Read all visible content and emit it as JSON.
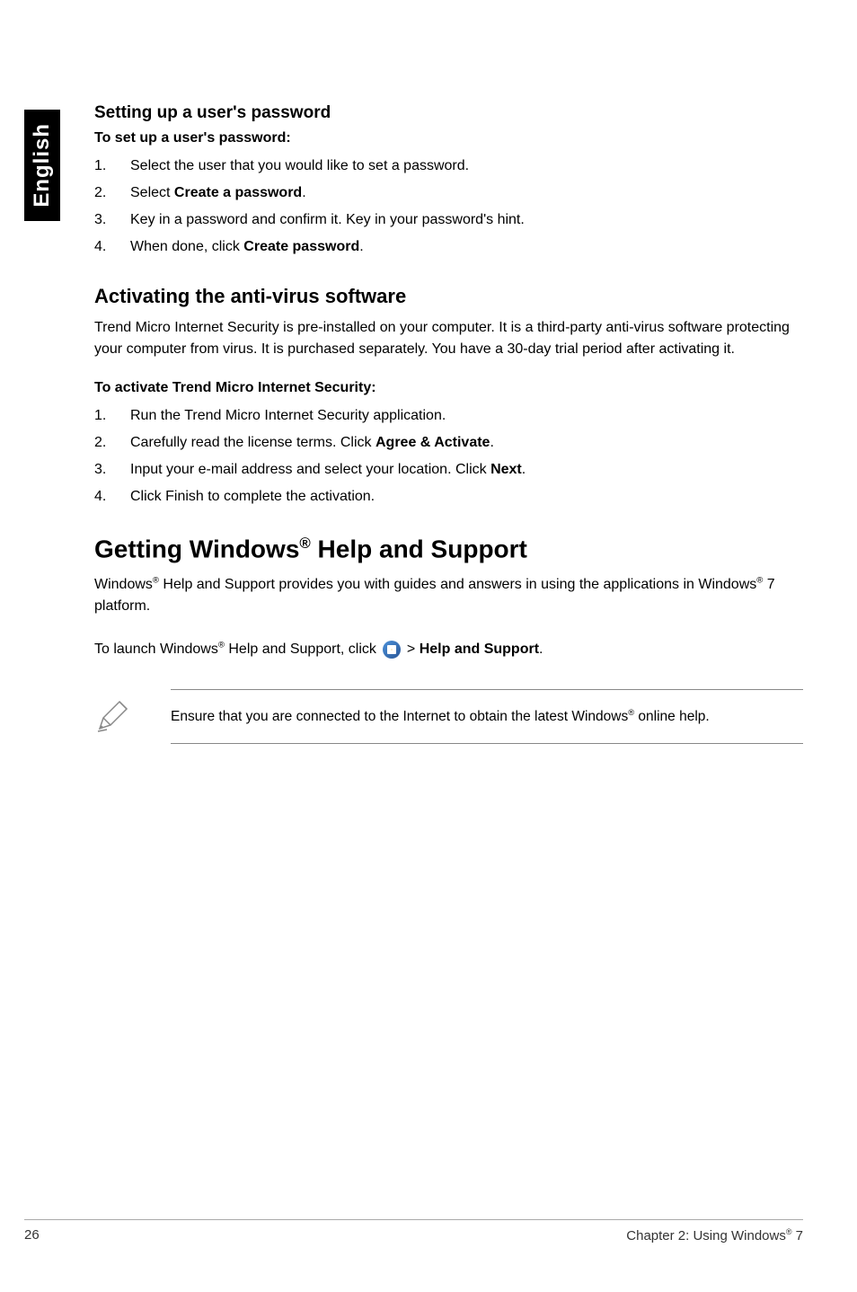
{
  "sideTab": "English",
  "section1": {
    "title": "Setting up a user's password",
    "intro": "To set up a user's password:",
    "items": [
      {
        "num": "1.",
        "pre": "Select the user that you would like to set a password."
      },
      {
        "num": "2.",
        "pre": "Select ",
        "bold": "Create a password",
        "post": "."
      },
      {
        "num": "3.",
        "pre": "Key in a password and confirm it. Key in your password's hint."
      },
      {
        "num": "4.",
        "pre": "When done, click ",
        "bold": "Create password",
        "post": "."
      }
    ]
  },
  "section2": {
    "title": "Activating the anti-virus software",
    "desc": "Trend Micro Internet Security is pre-installed on your computer. It is a third-party anti-virus software protecting your computer from virus. It is purchased separately. You have a 30-day trial period after activating it.",
    "intro": "To activate Trend Micro Internet Security:",
    "items": [
      {
        "num": "1.",
        "pre": "Run the Trend Micro Internet Security application."
      },
      {
        "num": "2.",
        "pre": "Carefully read the license terms. Click ",
        "bold": "Agree & Activate",
        "post": "."
      },
      {
        "num": "3.",
        "pre": "Input your e-mail address and select your location. Click ",
        "bold": "Next",
        "post": "."
      },
      {
        "num": "4.",
        "pre": "Click Finish to complete the activation."
      }
    ]
  },
  "section3": {
    "titlePre": "Getting Windows",
    "titleSup": "®",
    "titlePost": " Help and Support",
    "descPre": "Windows",
    "descSup": "®",
    "descMid": " Help and Support provides you with guides and answers in using the applications in Windows",
    "descSup2": "®",
    "descPost": " 7 platform.",
    "launchPre": "To launch Windows",
    "launchSup": "®",
    "launchMid": " Help and Support, click ",
    "launchGt": " > ",
    "launchBold": "Help and Support",
    "launchPost": ".",
    "notePre": "Ensure that you are connected to the Internet to obtain the latest Windows",
    "noteSup": "®",
    "notePost": " online help."
  },
  "footer": {
    "pageNum": "26",
    "chapterPre": "Chapter 2: Using Windows",
    "chapterSup": "®",
    "chapterPost": " 7"
  }
}
